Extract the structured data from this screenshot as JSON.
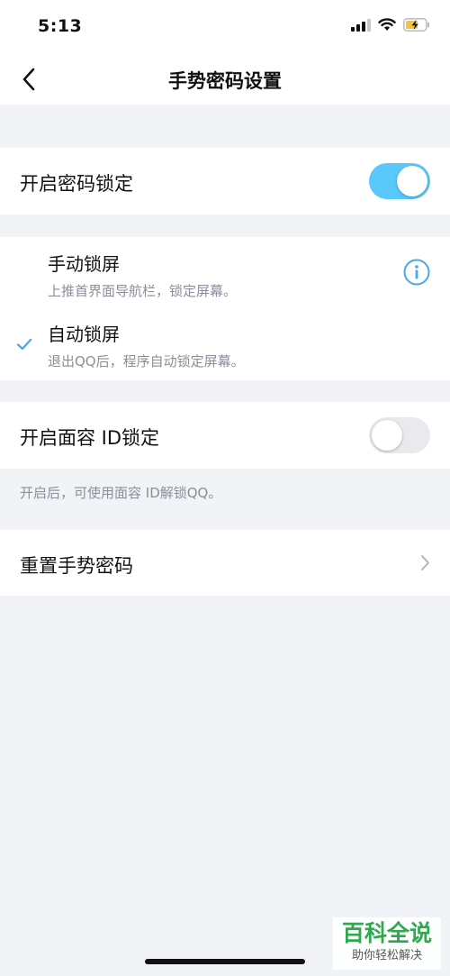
{
  "status_bar": {
    "time": "5:13",
    "icons": [
      "signal-icon",
      "wifi-icon",
      "battery-charging-icon"
    ]
  },
  "nav": {
    "back_icon": "chevron-left-icon",
    "title": "手势密码设置"
  },
  "password_lock": {
    "label": "开启密码锁定",
    "enabled": true
  },
  "lock_modes": {
    "manual": {
      "title": "手动锁屏",
      "description": "上推首界面导航栏，锁定屏幕。",
      "selected": false,
      "info_icon": "info-icon"
    },
    "auto": {
      "title": "自动锁屏",
      "description": "退出QQ后，程序自动锁定屏幕。",
      "selected": true,
      "check_icon": "checkmark-icon"
    }
  },
  "face_id_lock": {
    "label": "开启面容 ID锁定",
    "enabled": false,
    "note": "开启后，可使用面容 ID解锁QQ。"
  },
  "reset": {
    "label": "重置手势密码",
    "chevron_icon": "chevron-right-icon"
  },
  "watermark": {
    "brand": "百科全说",
    "slogan": "助你轻松解决"
  },
  "colors": {
    "toggle_on": "#5ac8fa",
    "toggle_off": "#e9e9ee",
    "check": "#4aa8e8",
    "info": "#4aa8e8",
    "background": "#f2f3f7",
    "watermark_green": "#2fa84f"
  }
}
